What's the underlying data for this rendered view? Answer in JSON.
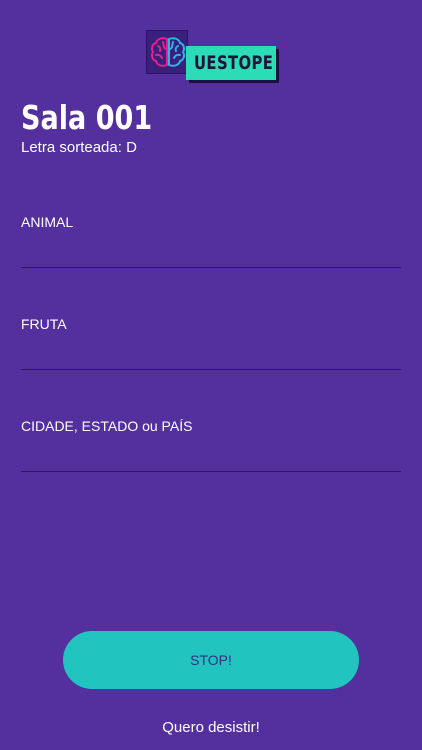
{
  "logo": {
    "text": "UESTOPE",
    "icon": "brain-icon",
    "colors": {
      "brain_left": "#e6218a",
      "brain_right": "#2bb6e6",
      "tag_background": "#2bdcb6"
    }
  },
  "room": {
    "title": "Sala 001",
    "letter_line": "Letra sorteada: D"
  },
  "fields": [
    {
      "label": "ANIMAL",
      "value": ""
    },
    {
      "label": "FRUTA",
      "value": ""
    },
    {
      "label": "CIDADE, ESTADO ou PAÍS",
      "value": ""
    }
  ],
  "actions": {
    "stop_label": "STOP!",
    "quit_label": "Quero desistir!"
  },
  "colors": {
    "background": "#53309d",
    "button": "#21c4be",
    "button_text": "#3b2a86"
  }
}
